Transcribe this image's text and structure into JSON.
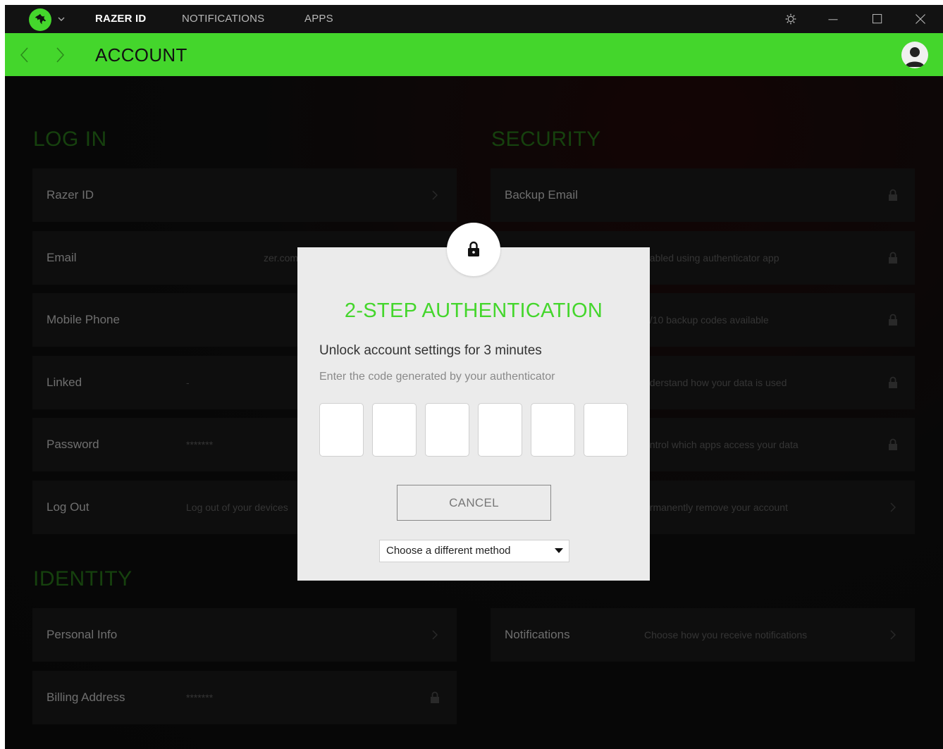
{
  "titlebar": {
    "tabs": [
      {
        "label": "RAZER ID",
        "active": true
      },
      {
        "label": "NOTIFICATIONS",
        "active": false
      },
      {
        "label": "APPS",
        "active": false
      }
    ],
    "icons": [
      "razer-logo-icon",
      "chevron-down-icon",
      "settings-icon",
      "minimize-icon",
      "maximize-icon",
      "close-icon"
    ]
  },
  "header": {
    "title": "ACCOUNT",
    "back_icon": "chevron-left-icon",
    "forward_icon": "chevron-right-icon",
    "avatar_icon": "user-avatar-icon"
  },
  "colors": {
    "accent": "#44d62c",
    "background": "#0a0a0a",
    "modal_bg": "#ebebeb",
    "section_title": "#1f5a14"
  },
  "login": {
    "title": "LOG IN",
    "rows": [
      {
        "label": "Razer ID",
        "value": "",
        "icon": "chevron-right-icon"
      },
      {
        "label": "Email",
        "value": "zer.com",
        "icon": "chevron-right-icon"
      },
      {
        "label": "Mobile Phone",
        "value": "",
        "icon": "chevron-right-icon"
      },
      {
        "label": "Linked",
        "value": "-",
        "icon": "chevron-right-icon"
      },
      {
        "label": "Password",
        "value": "*******",
        "icon": "chevron-right-icon"
      },
      {
        "label": "Log Out",
        "value": "Log out of your devices",
        "icon": "chevron-right-icon"
      }
    ]
  },
  "security": {
    "title": "SECURITY",
    "rows": [
      {
        "label": "Backup Email",
        "value": "",
        "icon": "lock-icon"
      },
      {
        "label": "",
        "value": "nabled using authenticator app",
        "icon": "lock-icon"
      },
      {
        "label": "",
        "value": "0/10 backup codes available",
        "icon": "lock-icon"
      },
      {
        "label": "",
        "value": "nderstand how your data is used",
        "icon": "lock-icon"
      },
      {
        "label": "",
        "value": "ontrol which apps access your data",
        "icon": "lock-icon"
      },
      {
        "label": "",
        "value": "ermanently remove your account",
        "icon": "chevron-right-icon"
      }
    ]
  },
  "identity": {
    "title": "IDENTITY",
    "rows": [
      {
        "label": "Personal Info",
        "value": "",
        "icon": "chevron-right-icon"
      },
      {
        "label": "Billing Address",
        "value": "*******",
        "icon": "lock-icon"
      }
    ]
  },
  "contact": {
    "rows": [
      {
        "label": "Notifications",
        "value": "Choose how you receive notifications",
        "icon": "chevron-right-icon"
      }
    ]
  },
  "modal": {
    "icon": "lock-icon",
    "title": "2-STEP AUTHENTICATION",
    "subtitle": "Unlock account settings for 3 minutes",
    "hint": "Enter the code generated by your authenticator",
    "code_digits": [
      "",
      "",
      "",
      "",
      "",
      ""
    ],
    "cancel_label": "CANCEL",
    "method_select": {
      "selected": "Choose a different method",
      "icon": "caret-down-icon"
    }
  }
}
